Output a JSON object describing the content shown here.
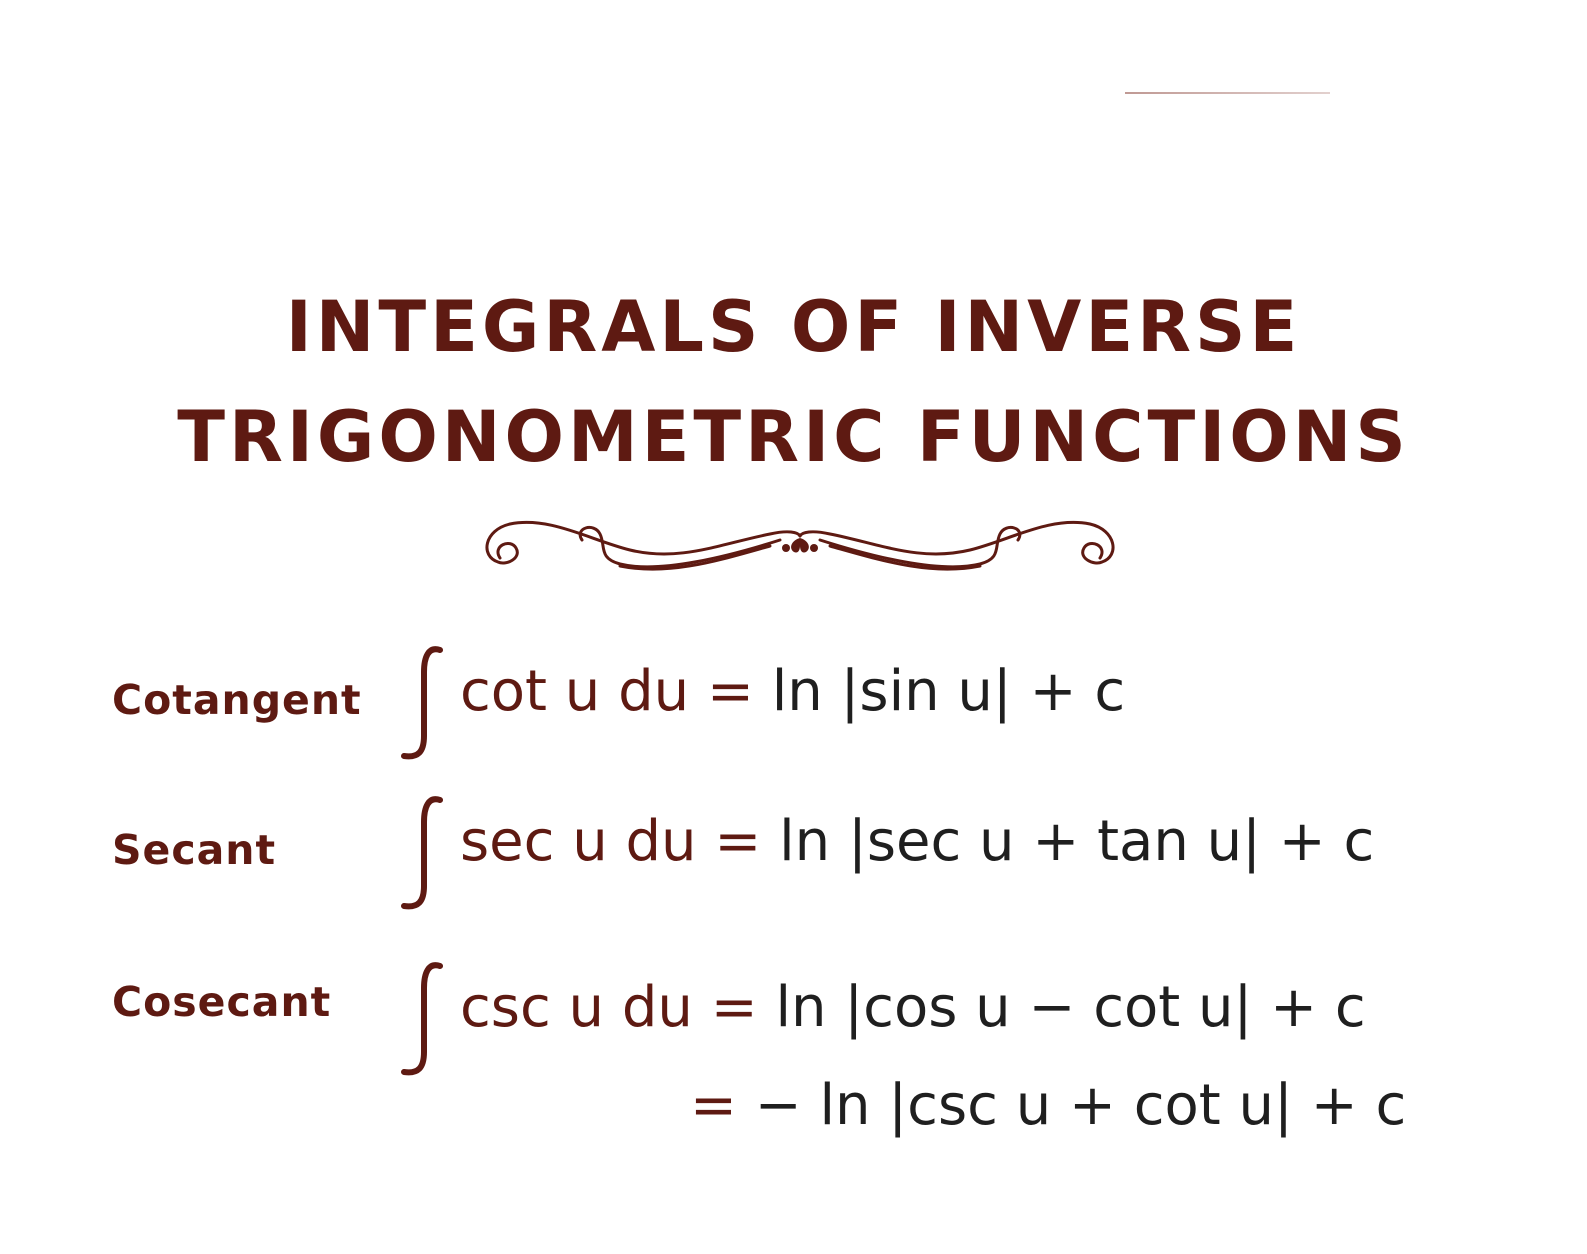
{
  "title": {
    "line1": "INTEGRALS OF INVERSE",
    "line2": "TRIGONOMETRIC FUNCTIONS"
  },
  "colors": {
    "accent": "#5e1a12",
    "formula_text": "#1f1f1f",
    "background": "#ffffff"
  },
  "rows": [
    {
      "label": "Cotangent",
      "lhs": "cot u du",
      "eq": "=",
      "rhs": "ln |sin u| + c"
    },
    {
      "label": "Secant",
      "lhs": "sec u du",
      "eq": "=",
      "rhs": "ln |sec u + tan u| + c"
    },
    {
      "label": "Cosecant",
      "lhs": "csc u du",
      "eq": "=",
      "rhs": "ln |cos u − cot u| + c",
      "continuation": {
        "eq": "=",
        "rhs": "− ln |csc u + cot u| + c"
      }
    }
  ]
}
